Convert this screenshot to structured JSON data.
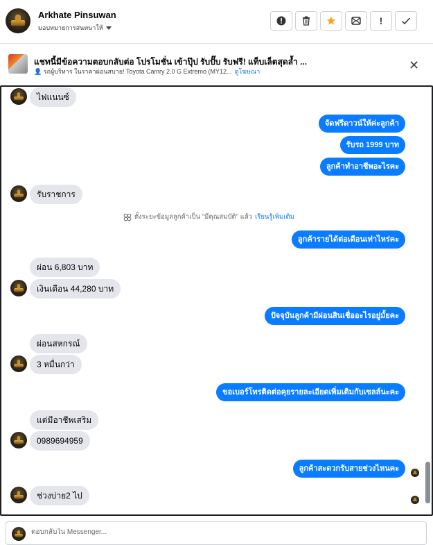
{
  "header": {
    "name": "Arkhate Pinsuwan",
    "assigned_label": "มอบหมายการสนทนาให้",
    "tools": [
      {
        "icon": "alert-circle-icon",
        "glyph": "❗"
      },
      {
        "icon": "trash-icon",
        "glyph": "🗑"
      },
      {
        "icon": "star-icon",
        "glyph": "★",
        "color": "#f5a623"
      },
      {
        "icon": "mark-unread-icon",
        "glyph": "✉"
      },
      {
        "icon": "exclamation-icon",
        "glyph": "!"
      },
      {
        "icon": "checkmark-icon",
        "glyph": "✓"
      }
    ]
  },
  "promo": {
    "title": "แชทนี้มีข้อความตอบกลับต่อ โปรโมชั่น เข้าปุ๊ป รับปั๊บ รับฟรี! แท็บเล็ตสุดล้ำ ...",
    "subtitle": "👤 รถผู้บริหาร ในราคาผ่อนสบาย! Toyota Camry 2.0 G Extremo (MY12...",
    "link": "ดูโฆษณา"
  },
  "system_note": {
    "text": "ตั้งระยะข้อมูลลูกค้าเป็น \"มีคุณสมบัติ\" แล้ว",
    "link": "เรียนรู้เพิ่มเติม"
  },
  "messages": [
    {
      "dir": "in",
      "text": "ไฟแนนซ์"
    },
    {
      "dir": "out",
      "text": "จัดฟรีดาวน์ให้ค่ะลูกค้า"
    },
    {
      "dir": "out",
      "text": "รับรถ  1999  บาท"
    },
    {
      "dir": "out",
      "text": "ลูกค้าทำอาชีพอะไรคะ"
    },
    {
      "dir": "in",
      "text": "รับราชการ"
    },
    {
      "dir": "out",
      "text": "ลูกค้ารายได้ต่อเดือนเท่าไหร่คะ"
    },
    {
      "dir": "in",
      "text": "ผ่อน 6,803 บาท"
    },
    {
      "dir": "in",
      "text": "เงินเดือน 44,280 บาท"
    },
    {
      "dir": "out",
      "text": "ปัจจุบันลูกค้ามีผ่อนสินเชื่ออะไรอยู่มั้ยคะ"
    },
    {
      "dir": "in",
      "text": "ผ่อนสหกรณ์"
    },
    {
      "dir": "in",
      "text": "3 หมื่นกว่า"
    },
    {
      "dir": "out",
      "text": "ขอเบอร์โทรติดต่อคุยรายละเอียดเพิ่มเติมกับเซลล์นะคะ"
    },
    {
      "dir": "in",
      "text": "แต่มีอาชีพเสริม"
    },
    {
      "dir": "in",
      "text": "0989694959"
    },
    {
      "dir": "out",
      "text": "ลูกค้าสะดวกรับสายช่วงไหนคะ"
    },
    {
      "dir": "in",
      "text": "ช่วงบ่าย2 ไป"
    }
  ],
  "composer": {
    "placeholder": "ตอบกลับใน Messenger..."
  },
  "colors": {
    "outgoing": "#0a7cff",
    "incoming": "#e4e6eb",
    "star": "#f5a623"
  }
}
